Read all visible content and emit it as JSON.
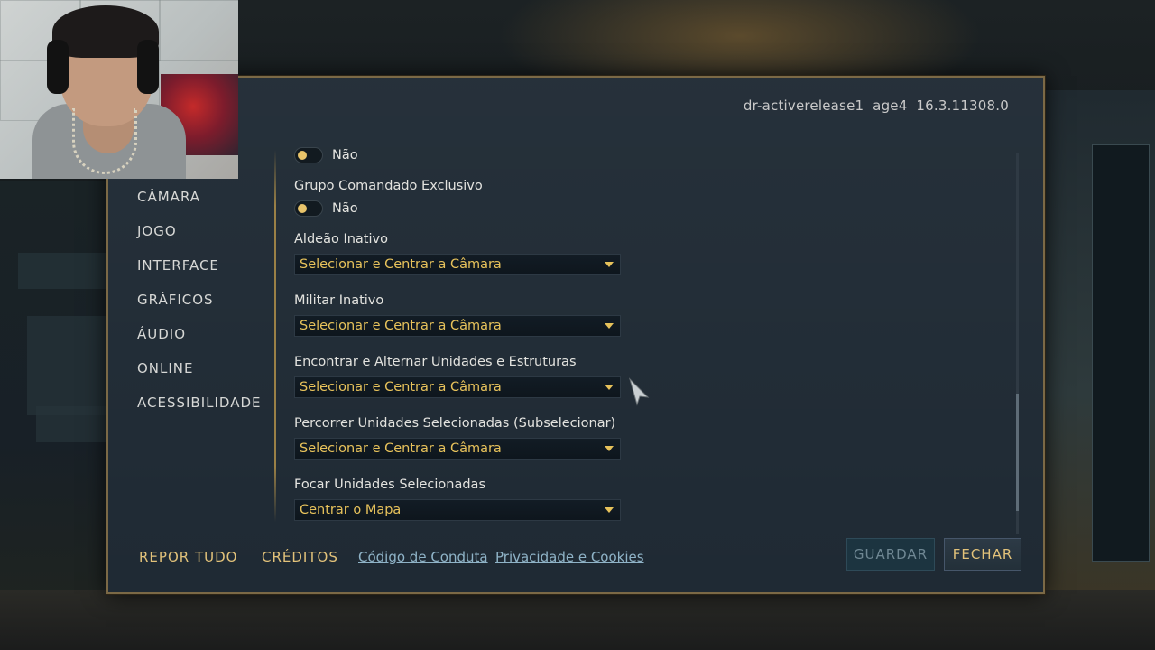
{
  "build_info": "dr-activerelease1  age4  16.3.11308.0",
  "nav": {
    "items": [
      {
        "id": "camera",
        "label": "CÂMARA"
      },
      {
        "id": "game",
        "label": "JOGO"
      },
      {
        "id": "interface",
        "label": "INTERFACE"
      },
      {
        "id": "graphics",
        "label": "GRÁFICOS"
      },
      {
        "id": "audio",
        "label": "ÁUDIO"
      },
      {
        "id": "online",
        "label": "ONLINE"
      },
      {
        "id": "accessibility",
        "label": "ACESSIBILIDADE"
      }
    ]
  },
  "settings": {
    "top_toggle": {
      "value": "Não"
    },
    "grupo_comandado": {
      "label": "Grupo Comandado Exclusivo",
      "value": "Não"
    },
    "aldeao_inativo": {
      "label": "Aldeão Inativo",
      "value": "Selecionar e Centrar a Câmara"
    },
    "militar_inativo": {
      "label": "Militar Inativo",
      "value": "Selecionar e Centrar a Câmara"
    },
    "encontrar_alternar": {
      "label": "Encontrar e Alternar Unidades e Estruturas",
      "value": "Selecionar e Centrar a Câmara"
    },
    "percorrer_unidades": {
      "label": "Percorrer Unidades Selecionadas (Subselecionar)",
      "value": "Selecionar e Centrar a Câmara"
    },
    "focar_unidades": {
      "label": "Focar Unidades Selecionadas",
      "value": "Centrar o Mapa"
    }
  },
  "footer": {
    "reset_label": "REPOR TUDO",
    "credits_label": "CRÉDITOS",
    "code_of_conduct": "Código de Conduta",
    "privacy": "Privacidade e Cookies",
    "save_label": "GUARDAR",
    "close_label": "FECHAR"
  },
  "colors": {
    "accent_gold": "#e7c25b",
    "panel_bg": "#1f2a34",
    "link_blue": "#8fb3c7"
  }
}
